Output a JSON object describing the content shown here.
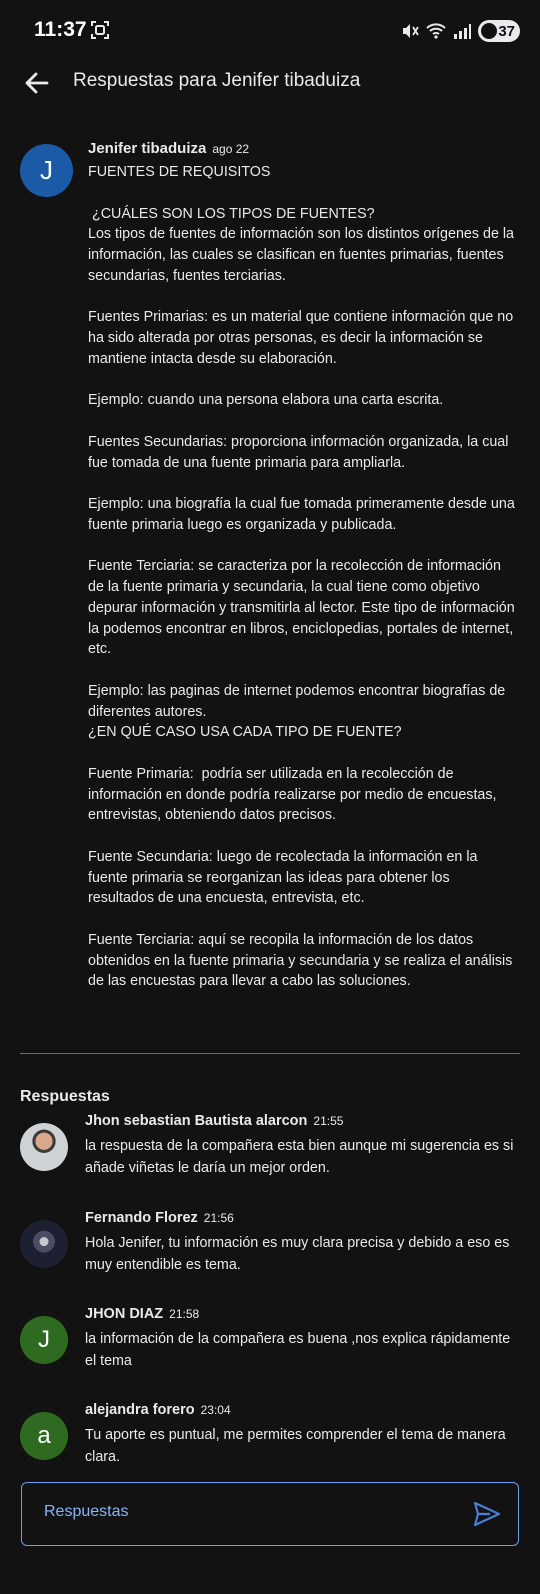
{
  "status_bar": {
    "time": "11:37",
    "battery": "37",
    "icons": [
      "screenshot-icon",
      "mute-icon",
      "wifi-icon",
      "signal-icon",
      "battery-icon"
    ]
  },
  "header": {
    "title": "Respuestas para Jenifer tibaduiza",
    "back_icon": "arrow-back-icon"
  },
  "post": {
    "avatar_letter": "J",
    "author": "Jenifer tibaduiza",
    "time": "ago 22",
    "body": "FUENTES DE REQUISITOS\n\n ¿CUÁLES SON LOS TIPOS DE FUENTES?\nLos tipos de fuentes de información son los distintos orígenes de la información, las cuales se clasifican en fuentes primarias, fuentes secundarias, fuentes terciarias.\n\nFuentes Primarias: es un material que contiene información que no ha sido alterada por otras personas, es decir la información se mantiene intacta desde su elaboración.\n\nEjemplo: cuando una persona elabora una carta escrita.\n\nFuentes Secundarias: proporciona información organizada, la cual fue tomada de una fuente primaria para ampliarla.\n\nEjemplo: una biografía la cual fue tomada primeramente desde una fuente primaria luego es organizada y publicada.\n\nFuente Terciaria: se caracteriza por la recolección de información de la fuente primaria y secundaria, la cual tiene como objetivo depurar información y transmitirla al lector. Este tipo de información la podemos encontrar en libros, enciclopedias, portales de internet, etc.\n\nEjemplo: las paginas de internet podemos encontrar biografías de diferentes autores.\n¿EN QUÉ CASO USA CADA TIPO DE FUENTE?\n\nFuente Primaria:  podría ser utilizada en la recolección de información en donde podría realizarse por medio de encuestas, entrevistas, obteniendo datos precisos.\n\nFuente Secundaria: luego de recolectada la información en la fuente primaria se reorganizan las ideas para obtener los resultados de una encuesta, entrevista, etc.\n\nFuente Terciaria: aquí se recopila la información de los datos obtenidos en la fuente primaria y secundaria y se realiza el análisis de las encuestas para llevar a cabo las soluciones."
  },
  "replies_heading": "Respuestas",
  "replies": [
    {
      "author": "Jhon sebastian Bautista alarcon",
      "time": "21:55",
      "text": "la respuesta de la compañera esta bien aunque mi sugerencia es si añade viñetas le daría un mejor orden.",
      "avatar": "photo",
      "avatar_letter": ""
    },
    {
      "author": "Fernando Florez",
      "time": "21:56",
      "text": "Hola Jenifer,  tu  información es muy  clara precisa y debido a eso es muy entendible es tema.",
      "avatar": "photo",
      "avatar_letter": ""
    },
    {
      "author": "JHON DIAZ",
      "time": "21:58",
      "text": "la información de la compañera es buena ,nos explica rápidamente  el tema",
      "avatar": "letter",
      "avatar_letter": "J"
    },
    {
      "author": "alejandra forero",
      "time": "23:04",
      "text": "Tu  aporte es puntual, me permites comprender el tema de manera clara.",
      "avatar": "letter",
      "avatar_letter": "a"
    }
  ],
  "composer": {
    "placeholder": "Respuestas",
    "send_icon": "send-icon"
  },
  "colors": {
    "background": "#121212",
    "post_avatar": "#1b5aa6",
    "reply_avatar_green": "#2e6b20",
    "accent": "#8ab4f8"
  }
}
